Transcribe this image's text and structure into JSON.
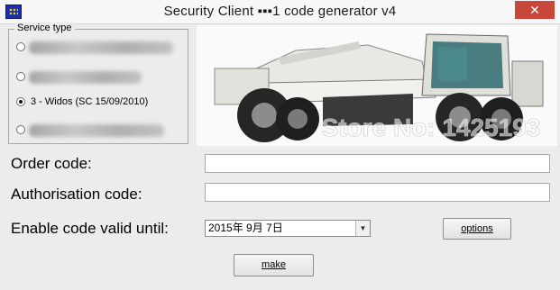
{
  "window": {
    "title": "Security Client ▪▪▪1 code generator v4",
    "close_glyph": "✕"
  },
  "service_type": {
    "label": "Service type",
    "options": [
      {
        "label": "",
        "checked": false
      },
      {
        "label": "",
        "checked": false
      },
      {
        "label": "3 - Widos (SC 15/09/2010)",
        "checked": true
      },
      {
        "label": "",
        "checked": false
      }
    ]
  },
  "watermark": "Store No: 1425193",
  "form": {
    "order_code_label": "Order code:",
    "order_code_value": "",
    "authorisation_code_label": "Authorisation code:",
    "authorisation_code_value": "",
    "valid_until_label": "Enable code valid until:",
    "valid_until_value": "2015年  9月  7日",
    "options_button": "options",
    "make_button": "make"
  },
  "icons": {
    "app": "app-icon",
    "close": "close-icon",
    "dropdown": "chevron-down-icon"
  }
}
